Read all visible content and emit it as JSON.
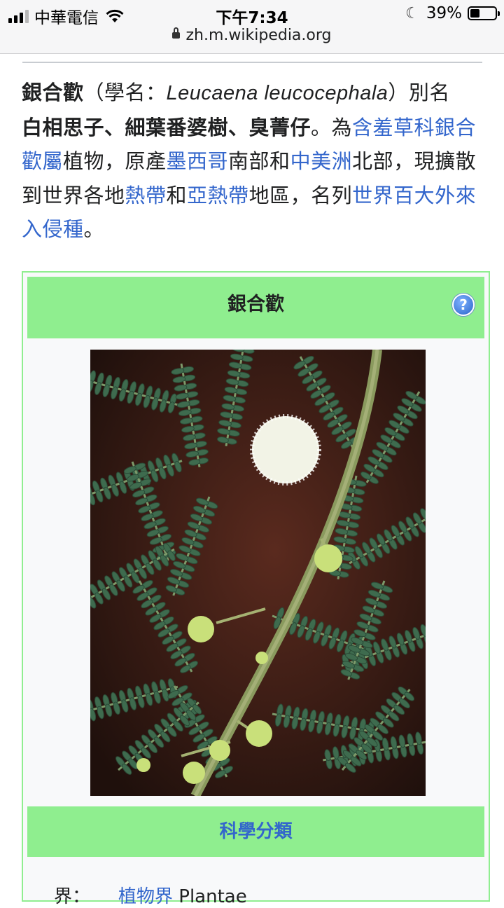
{
  "status_bar": {
    "carrier": "中華電信",
    "time": "下午7:34",
    "battery_percent": "39%",
    "battery_level": 0.39
  },
  "url_bar": {
    "domain": "zh.m.wikipedia.org"
  },
  "article": {
    "p1_term": "銀合歡",
    "p1_open": "（學名：",
    "p1_sci": "Leucaena leucocephala",
    "p1_close": "）別名",
    "p1_aliases": "白相思子、細葉番婆樹、臭菁仔",
    "p1_wei": "。為",
    "link_family": "含羞草科銀合歡屬",
    "txt_plant": "植物，原產",
    "link_mexico": "墨西哥",
    "txt_south": "南部和",
    "link_central_america": "中美洲",
    "txt_north": "北部，現擴散到世界各地",
    "link_tropics": "熱帶",
    "txt_and": "和",
    "link_subtropics": "亞熱帶",
    "txt_region": "地區，名列",
    "link_invasive": "世界百大外來入侵種",
    "txt_end": "。"
  },
  "infobox": {
    "title": "銀合歡",
    "help_icon": "?",
    "section_header": "科學分類",
    "rows": [
      {
        "label": "界：",
        "link": "植物界",
        "latin": " Plantae"
      }
    ]
  },
  "colors": {
    "link": "#3366cc",
    "infobox_header": "#8fee8f",
    "infobox_border": "#90ee90",
    "text": "#202122"
  }
}
